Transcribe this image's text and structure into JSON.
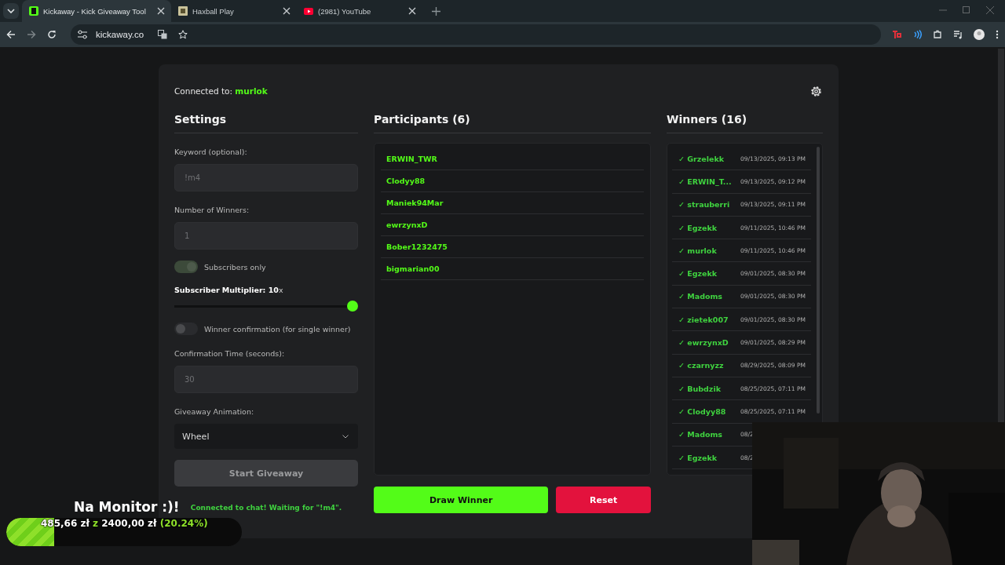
{
  "browser": {
    "tabs": [
      {
        "title": "Kickaway - Kick Giveaway Tool",
        "selected": true
      },
      {
        "title": "Haxball Play",
        "selected": false
      },
      {
        "title": "(2981) YouTube",
        "selected": false
      }
    ],
    "url": "kickaway.co"
  },
  "app": {
    "connected_label": "Connected to:",
    "channel": "murlok",
    "settings": {
      "title": "Settings",
      "fields": [
        {
          "kind": "input",
          "label": "Keyword (optional):",
          "placeholder": "!m4"
        },
        {
          "kind": "input",
          "label": "Number of Winners:",
          "placeholder": "1"
        },
        {
          "kind": "toggle",
          "label": "Subscribers only",
          "on": true
        },
        {
          "kind": "slider",
          "label": "**Subscriber Multiplier: 10**x",
          "level": 1
        },
        {
          "kind": "toggle",
          "label": "Winner confirmation (for single winner)",
          "on": false
        },
        {
          "kind": "input",
          "label": "Confirmation Time (seconds):",
          "placeholder": "30"
        },
        {
          "kind": "select",
          "label": "Giveaway Animation:",
          "value": "Wheel"
        }
      ],
      "start_button": "Start Giveaway",
      "status": "Connected to chat! Waiting for \"!m4\"."
    },
    "participants": {
      "title": "Participants (6)",
      "names": [
        "ERWIN_TWR",
        "Clodyy88",
        "Maniek94Mar",
        "ewrzynxD",
        "Bober1232475",
        "bigmarian00"
      ]
    },
    "winners": {
      "title": "Winners (16)",
      "rows": [
        {
          "name": "✓ Grzelekk",
          "time": "09/13/2025, 09:13 PM"
        },
        {
          "name": "✓ ERWIN_T...",
          "time": "09/13/2025, 09:12 PM"
        },
        {
          "name": "✓ strauberri",
          "time": "09/13/2025, 09:11 PM"
        },
        {
          "name": "✓ Egzekk",
          "time": "09/11/2025, 10:46 PM"
        },
        {
          "name": "✓ murlok",
          "time": "09/11/2025, 10:46 PM"
        },
        {
          "name": "✓ Egzekk",
          "time": "09/01/2025, 08:30 PM"
        },
        {
          "name": "✓ Madoms",
          "time": "09/01/2025, 08:30 PM"
        },
        {
          "name": "✓ zietek007",
          "time": "09/01/2025, 08:30 PM"
        },
        {
          "name": "✓ ewrzynxD",
          "time": "09/01/2025, 08:29 PM"
        },
        {
          "name": "✓ czarnyzz",
          "time": "08/29/2025, 08:09 PM"
        },
        {
          "name": "✓ Bubdzik",
          "time": "08/25/2025, 07:11 PM"
        },
        {
          "name": "✓ Clodyy88",
          "time": "08/25/2025, 07:11 PM"
        },
        {
          "name": "✓ Madoms",
          "time": "08/2"
        },
        {
          "name": "✓ Egzekk",
          "time": "08/2"
        }
      ]
    },
    "buttons": {
      "draw": "Draw Winner",
      "reset": "Reset"
    }
  },
  "overlay": {
    "goal_title": "Na Monitor :)!",
    "raised": "485,66 zł",
    "separator": "z",
    "target": "2400,00 zł",
    "percent": "(20.24%)",
    "level": 0.2024
  }
}
